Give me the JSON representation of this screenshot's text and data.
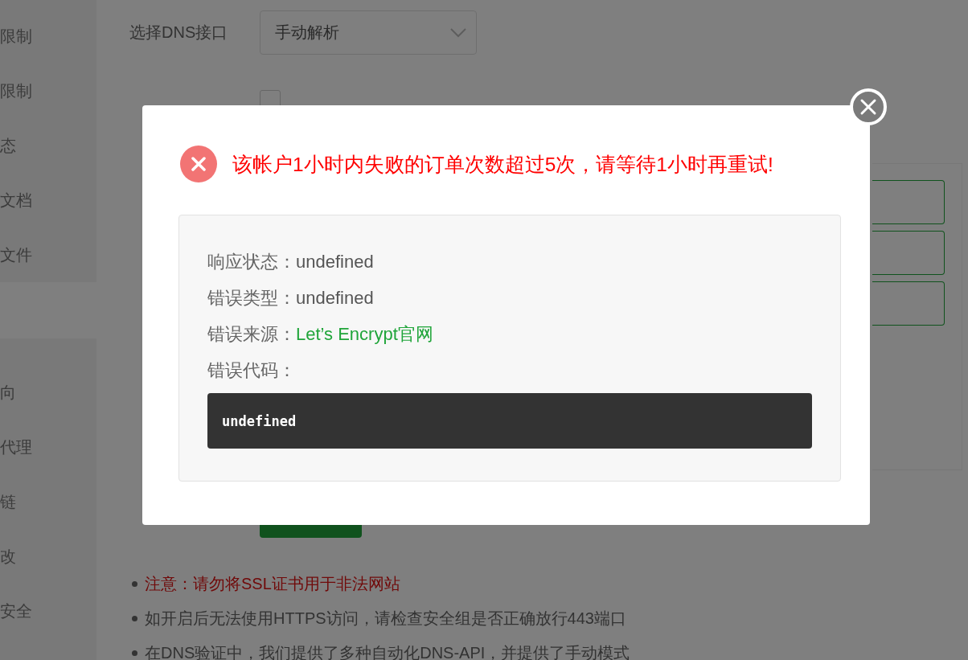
{
  "sidebar": {
    "groups": [
      {
        "items": [
          {
            "label": "限制"
          },
          {
            "label": "限制"
          },
          {
            "label": "态"
          },
          {
            "label": "文档"
          },
          {
            "label": "文件"
          }
        ]
      },
      {
        "items": [
          {
            "label": "向"
          },
          {
            "label": "代理"
          },
          {
            "label": "链"
          },
          {
            "label": "改"
          },
          {
            "label": "安全"
          }
        ]
      }
    ]
  },
  "form": {
    "dns_label": "选择DNS接口",
    "dns_select": {
      "value": "手动解析"
    },
    "wildcard_checkbox": {
      "checked": false
    }
  },
  "notes": [
    {
      "kind": "warning",
      "text": "注意：请勿将SSL证书用于非法网站"
    },
    {
      "kind": "info",
      "text": "如开启后无法使用HTTPS访问，请检查安全组是否正确放行443端口"
    },
    {
      "kind": "info",
      "text": "在DNS验证中，我们提供了多种自动化DNS-API，并提供了手动模式"
    }
  ],
  "dialog": {
    "message": "该帐户1小时内失败的订单次数超过5次，请等待1小时再重试!",
    "details": [
      {
        "kind": "text",
        "label": "响应状态：",
        "value": "undefined"
      },
      {
        "kind": "text",
        "label": "错误类型：",
        "value": "undefined"
      },
      {
        "kind": "link",
        "label": "错误来源：",
        "value": "Let’s Encrypt官网"
      },
      {
        "label": "错误代码："
      }
    ],
    "code": "undefined"
  }
}
